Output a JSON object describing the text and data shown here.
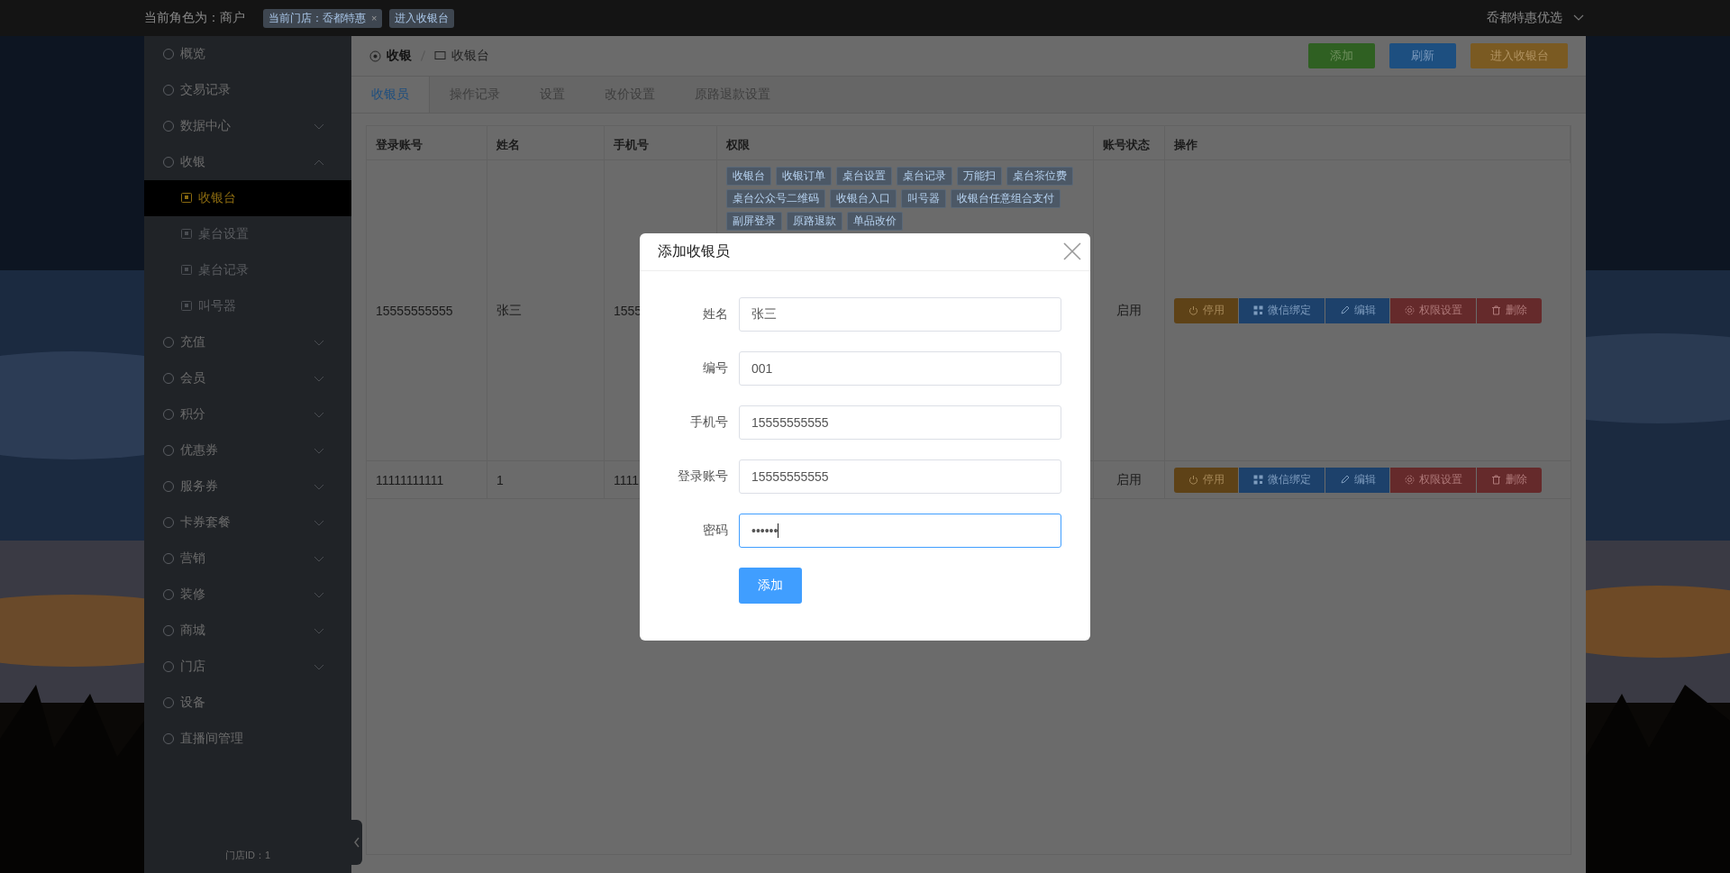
{
  "top_bar": {
    "role_text": "当前角色为：商户",
    "store_tag": {
      "label": "当前门店：岙都特惠",
      "close": "×"
    },
    "enter_button": "进入收银台",
    "account": "岙都特惠优选"
  },
  "sidebar": {
    "items": [
      {
        "label": "概览",
        "kind": "link",
        "selected": false
      },
      {
        "label": "交易记录",
        "kind": "link",
        "selected": false
      },
      {
        "label": "数据中心",
        "kind": "group",
        "expanded": false,
        "selected": false
      },
      {
        "label": "收银",
        "kind": "group",
        "expanded": true,
        "selected": false,
        "children": [
          {
            "label": "收银台",
            "selected": true
          },
          {
            "label": "桌台设置",
            "selected": false
          },
          {
            "label": "桌台记录",
            "selected": false
          },
          {
            "label": "叫号器",
            "selected": false
          }
        ]
      },
      {
        "label": "充值",
        "kind": "group",
        "expanded": false,
        "selected": false
      },
      {
        "label": "会员",
        "kind": "group",
        "expanded": false,
        "selected": false
      },
      {
        "label": "积分",
        "kind": "group",
        "expanded": false,
        "selected": false
      },
      {
        "label": "优惠券",
        "kind": "group",
        "expanded": false,
        "selected": false
      },
      {
        "label": "服务券",
        "kind": "group",
        "expanded": false,
        "selected": false
      },
      {
        "label": "卡券套餐",
        "kind": "group",
        "expanded": false,
        "selected": false
      },
      {
        "label": "营销",
        "kind": "group",
        "expanded": false,
        "selected": false
      },
      {
        "label": "装修",
        "kind": "group",
        "expanded": false,
        "selected": false
      },
      {
        "label": "商城",
        "kind": "group",
        "expanded": false,
        "selected": false
      },
      {
        "label": "门店",
        "kind": "group",
        "expanded": false,
        "selected": false
      },
      {
        "label": "设备",
        "kind": "link",
        "selected": false
      },
      {
        "label": "直播间管理",
        "kind": "link",
        "selected": false
      }
    ],
    "footer": "门店ID：1"
  },
  "breadcrumb": [
    "收银",
    "收银台"
  ],
  "header_buttons": [
    {
      "label": "添加",
      "kind": "add"
    },
    {
      "label": "刷新",
      "kind": "refresh"
    },
    {
      "label": "进入收银台",
      "kind": "enter"
    }
  ],
  "tabs": [
    {
      "label": "收银员",
      "selected": true
    },
    {
      "label": "操作记录",
      "selected": false
    },
    {
      "label": "设置",
      "selected": false
    },
    {
      "label": "改价设置",
      "selected": false
    },
    {
      "label": "原路退款设置",
      "selected": false
    }
  ],
  "table": {
    "columns": [
      "登录账号",
      "姓名",
      "手机号",
      "权限",
      "账号状态",
      "操作"
    ],
    "rows": [
      {
        "account": "15555555555",
        "name": "张三",
        "phone": "1555",
        "permissions": [
          "收银台",
          "收银订单",
          "桌台设置",
          "桌台记录",
          "万能扫",
          "桌台茶位费",
          "桌台公众号二维码",
          "收银台入口",
          "叫号器",
          "收银台任意组合支付",
          "副屏登录",
          "原路退款",
          "单品改价"
        ],
        "status": "启用",
        "actions": [
          {
            "label": "停用",
            "kind": "disable"
          },
          {
            "label": "微信绑定",
            "kind": "wechat"
          },
          {
            "label": "编辑",
            "kind": "edit"
          },
          {
            "label": "权限设置",
            "kind": "perm"
          },
          {
            "label": "删除",
            "kind": "delete"
          }
        ]
      },
      {
        "account": "11111111111",
        "name": "1",
        "phone": "1111",
        "permissions": [],
        "status": "启用",
        "actions": [
          {
            "label": "停用",
            "kind": "disable"
          },
          {
            "label": "微信绑定",
            "kind": "wechat"
          },
          {
            "label": "编辑",
            "kind": "edit"
          },
          {
            "label": "权限设置",
            "kind": "perm"
          },
          {
            "label": "删除",
            "kind": "delete"
          }
        ]
      }
    ]
  },
  "modal": {
    "title": "添加收银员",
    "fields": [
      {
        "label": "姓名",
        "value": "张三",
        "focused": false
      },
      {
        "label": "编号",
        "value": "001",
        "focused": false
      },
      {
        "label": "手机号",
        "value": "15555555555",
        "focused": false
      },
      {
        "label": "登录账号",
        "value": "15555555555",
        "focused": false
      },
      {
        "label": "密码",
        "value": "••••••",
        "focused": true
      }
    ],
    "submit": "添加"
  }
}
